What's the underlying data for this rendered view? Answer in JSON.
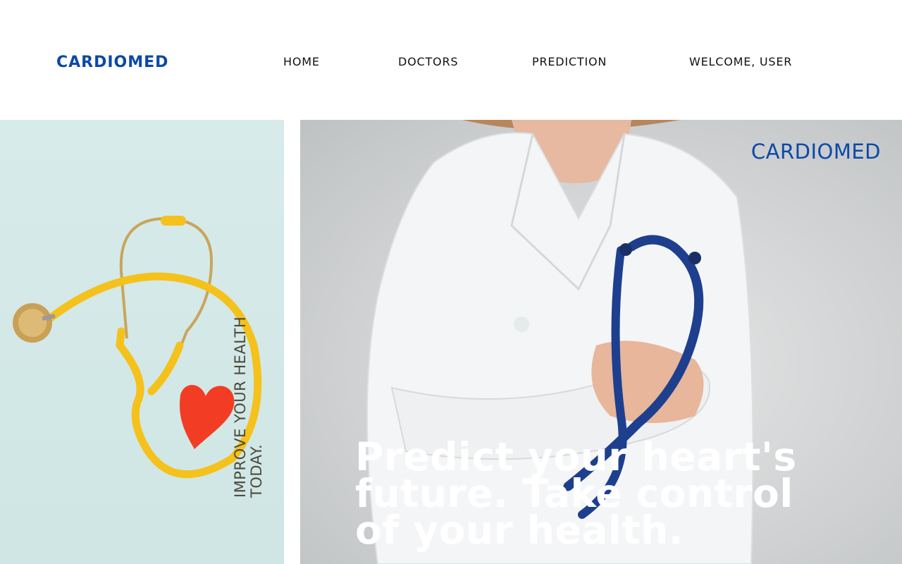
{
  "brand": {
    "logo": "CARDIOMED",
    "color": "#0b49a8"
  },
  "nav": {
    "home": "HOME",
    "doctors": "DOCTORS",
    "prediction": "PREDICTION",
    "welcome": "WELCOME, USER"
  },
  "left_panel": {
    "tagline": "IMPROVE YOUR HEALTH TODAY."
  },
  "hero": {
    "brand": "CARDIOMED",
    "headline": "Predict your heart's future. Take control of your health."
  },
  "colors": {
    "accent": "#0b49a8",
    "stethoscope_yellow": "#f5c11b",
    "heart_red": "#f23d24",
    "stethoscope_blue": "#1d3f8e"
  }
}
